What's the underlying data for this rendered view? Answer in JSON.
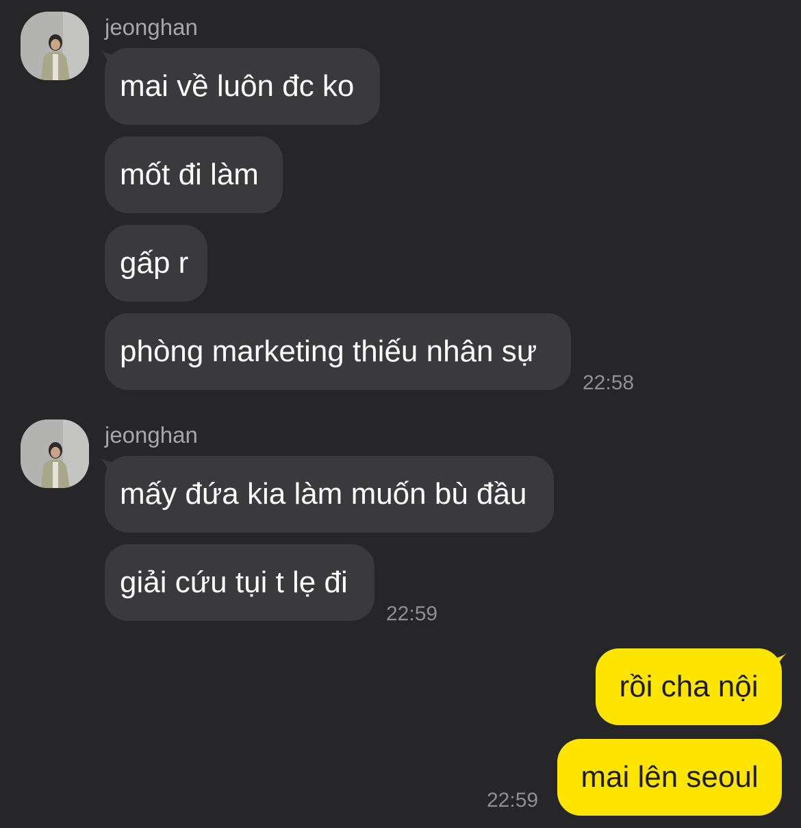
{
  "colors": {
    "background": "#262628",
    "incoming_bubble": "#3a3a3c",
    "outgoing_bubble": "#fde500",
    "incoming_text": "#ffffff",
    "outgoing_text": "#1d1d1f",
    "meta_text": "#8e8e93"
  },
  "groups": [
    {
      "sender": "jeonghan",
      "avatar_icon": "profile-photo",
      "messages": [
        "mai về luôn đc ko",
        "mốt đi làm",
        "gấp r",
        "phòng marketing thiếu nhân sự"
      ],
      "time": "22:58"
    },
    {
      "sender": "jeonghan",
      "avatar_icon": "profile-photo",
      "messages": [
        "mấy đứa kia làm muốn bù đầu",
        "giải cứu tụi t lẹ đi"
      ],
      "time": "22:59"
    }
  ],
  "outgoing": {
    "messages": [
      "rồi cha nội",
      "mai lên seoul"
    ],
    "time": "22:59"
  }
}
